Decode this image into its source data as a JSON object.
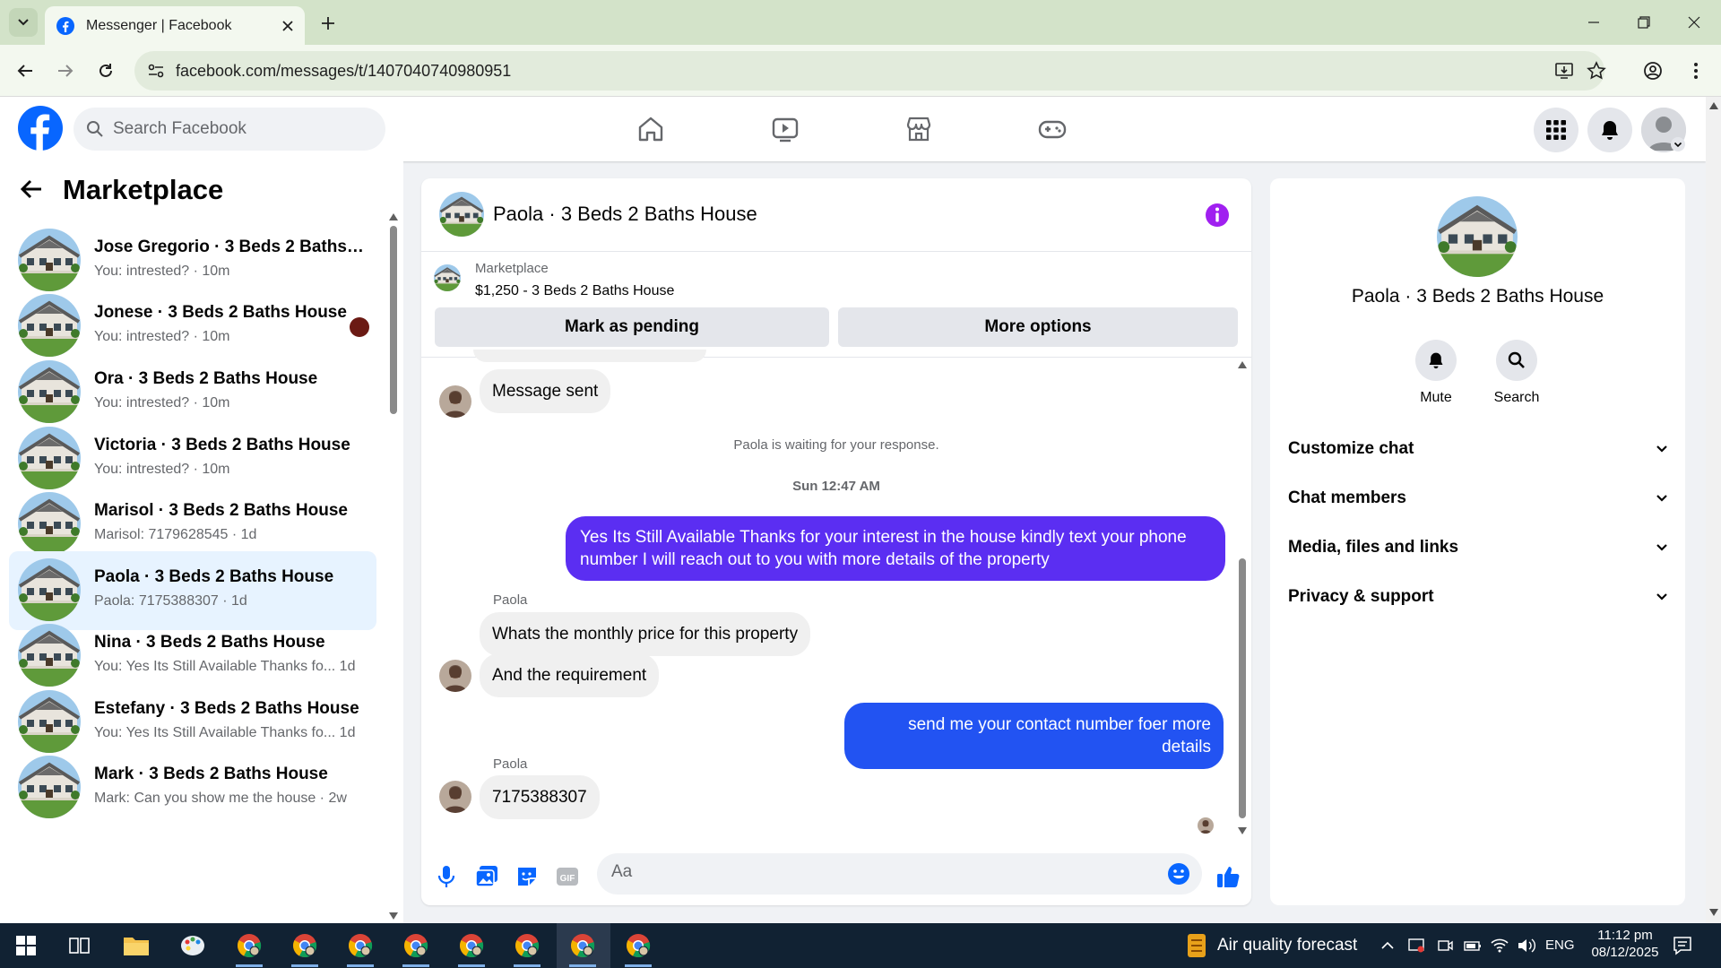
{
  "browser": {
    "tab_title": "Messenger | Facebook",
    "url": "facebook.com/messages/t/1407040740980951"
  },
  "header": {
    "search_placeholder": "Search Facebook"
  },
  "sidebar": {
    "title": "Marketplace",
    "conversations": [
      {
        "name": "Jose Gregorio · 3 Beds 2 Baths House",
        "name_display": "Jose Gregorio · 3 Beds 2 Baths H...",
        "preview": "You: intrested? · 10m",
        "active": false
      },
      {
        "name": "Jonese · 3 Beds 2 Baths House",
        "name_display": "Jonese · 3 Beds 2 Baths House",
        "preview": "You: intrested? · 10m",
        "active": false
      },
      {
        "name": "Ora · 3 Beds 2 Baths House",
        "name_display": "Ora · 3 Beds 2 Baths House",
        "preview": "You: intrested? · 10m",
        "active": false
      },
      {
        "name": "Victoria · 3 Beds 2 Baths House",
        "name_display": "Victoria · 3 Beds 2 Baths House",
        "preview": "You: intrested? · 10m",
        "active": false
      },
      {
        "name": "Marisol · 3 Beds 2 Baths House",
        "name_display": "Marisol · 3 Beds 2 Baths House",
        "preview": "Marisol: 7179628545 · 1d",
        "active": false
      },
      {
        "name": "Paola · 3 Beds 2 Baths House",
        "name_display": "Paola · 3 Beds 2 Baths House",
        "preview": "Paola: 7175388307 · 1d",
        "active": true
      },
      {
        "name": "Nina · 3 Beds 2 Baths House",
        "name_display": "Nina · 3 Beds 2 Baths House",
        "preview": "You: Yes Its Still Available Thanks fo...  1d",
        "active": false
      },
      {
        "name": "Estefany · 3 Beds 2 Baths House",
        "name_display": "Estefany · 3 Beds 2 Baths House",
        "preview": "You: Yes Its Still Available Thanks fo...  1d",
        "active": false
      },
      {
        "name": "Mark · 3 Beds 2 Baths House",
        "name_display": "Mark · 3 Beds 2 Baths House",
        "preview": "Mark: Can you show me the house · 2w",
        "active": false
      }
    ]
  },
  "chat": {
    "title": "Paola · 3 Beds 2 Baths House",
    "marketplace_label": "Marketplace",
    "listing": "$1,250 - 3 Beds 2 Baths House",
    "mark_pending": "Mark as pending",
    "more_options": "More options",
    "messages": [
      {
        "type": "in",
        "text": "Message sent"
      },
      {
        "type": "system",
        "text": "Paola is waiting for your response."
      },
      {
        "type": "time",
        "text": "Sun 12:47 AM"
      },
      {
        "type": "out",
        "text": "Yes Its Still Available Thanks for your interest in the house kindly text your phone number I will reach out to you with more details of the property"
      },
      {
        "type": "sender",
        "text": "Paola"
      },
      {
        "type": "in",
        "text": "Whats the monthly price for this property"
      },
      {
        "type": "in",
        "text": "And the requirement"
      },
      {
        "type": "out",
        "text": "send me your contact number foer more details"
      },
      {
        "type": "sender",
        "text": "Paola"
      },
      {
        "type": "in",
        "text": "7175388307"
      }
    ],
    "composer_placeholder": "Aa"
  },
  "info": {
    "name": "Paola · 3 Beds 2 Baths House",
    "mute": "Mute",
    "search": "Search",
    "sections": [
      "Customize chat",
      "Chat members",
      "Media, files and links",
      "Privacy & support"
    ]
  },
  "taskbar": {
    "weather": "Air quality forecast",
    "lang": "ENG",
    "time": "11:12 pm",
    "date": "08/12/2025"
  },
  "colors": {
    "fb_blue": "#0866ff",
    "outgoing_bubble": "#5b2ef2",
    "outgoing_bubble_2": "#2253f2",
    "info_icon": "#a020f0",
    "active_row": "#e7f3ff"
  }
}
